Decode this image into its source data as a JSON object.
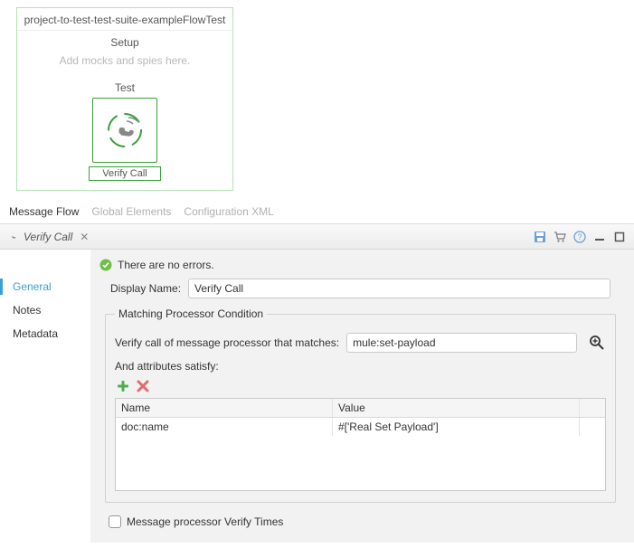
{
  "flow": {
    "title": "project-to-test-test-suite-exampleFlowTest",
    "setup": {
      "label": "Setup",
      "hint": "Add mocks and spies here."
    },
    "test": {
      "label": "Test"
    },
    "node": {
      "caption": "Verify Call"
    }
  },
  "bottomTabs": {
    "messageFlow": "Message Flow",
    "globalElements": "Global Elements",
    "configXml": "Configuration XML"
  },
  "panel": {
    "title": "Verify Call",
    "status": "There are no errors.",
    "sideTabs": {
      "general": "General",
      "notes": "Notes",
      "metadata": "Metadata"
    },
    "displayName": {
      "label": "Display Name:",
      "value": "Verify Call"
    },
    "match": {
      "legend": "Matching Processor Condition",
      "verifyLabel": "Verify call of message processor that matches:",
      "verifyValue": "mule:set-payload",
      "attrsLabel": "And attributes satisfy:",
      "columns": {
        "name": "Name",
        "value": "Value"
      },
      "rows": [
        {
          "name": "doc:name",
          "value": "#['Real Set Payload']"
        }
      ]
    },
    "verifyTimes": {
      "label": "Message processor Verify Times",
      "checked": false
    }
  },
  "icons": {
    "save": "save-icon",
    "cart": "cart-icon",
    "help": "help-icon",
    "min": "minimize-icon",
    "max": "maximize-icon",
    "add": "add-icon",
    "del": "delete-icon",
    "search": "search-plus-icon",
    "close": "close-icon",
    "verify": "verify-call-icon",
    "ok": "check-icon"
  },
  "colors": {
    "accent": "#3c9fd8",
    "green": "#3aa03a",
    "ok": "#5cb85c"
  }
}
